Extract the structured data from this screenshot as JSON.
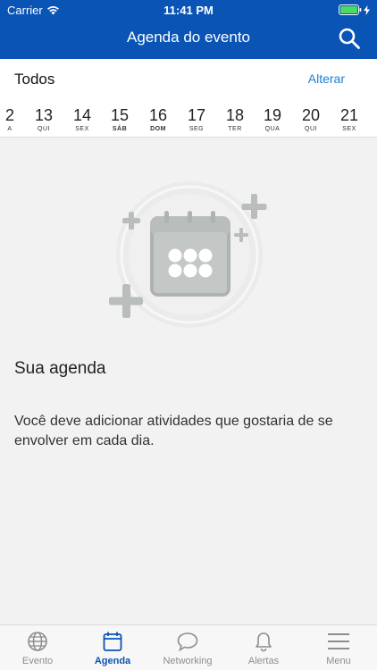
{
  "status": {
    "carrier": "Carrier",
    "time": "11:41 PM"
  },
  "nav": {
    "title": "Agenda do evento",
    "search_icon": "search-icon"
  },
  "filter": {
    "label": "Todos",
    "change_label": "Alterar"
  },
  "dates": [
    {
      "num": "2",
      "wd": "A"
    },
    {
      "num": "13",
      "wd": "QUI"
    },
    {
      "num": "14",
      "wd": "SEX"
    },
    {
      "num": "15",
      "wd": "SÁB"
    },
    {
      "num": "16",
      "wd": "DOM"
    },
    {
      "num": "17",
      "wd": "SEG"
    },
    {
      "num": "18",
      "wd": "TER"
    },
    {
      "num": "19",
      "wd": "QUA"
    },
    {
      "num": "20",
      "wd": "QUI"
    },
    {
      "num": "21",
      "wd": "SEX"
    }
  ],
  "empty": {
    "title": "Sua agenda",
    "description": "Você deve adicionar atividades que gostaria de se envolver em cada dia."
  },
  "tabs": [
    {
      "label": "Evento",
      "icon": "globe-icon"
    },
    {
      "label": "Agenda",
      "icon": "calendar-icon"
    },
    {
      "label": "Networking",
      "icon": "chat-bubble-icon"
    },
    {
      "label": "Alertas",
      "icon": "bell-icon"
    },
    {
      "label": "Menu",
      "icon": "hamburger-icon"
    }
  ],
  "colors": {
    "brand": "#0a54b5",
    "link": "#1a7fd6",
    "battery": "#4cd964"
  }
}
